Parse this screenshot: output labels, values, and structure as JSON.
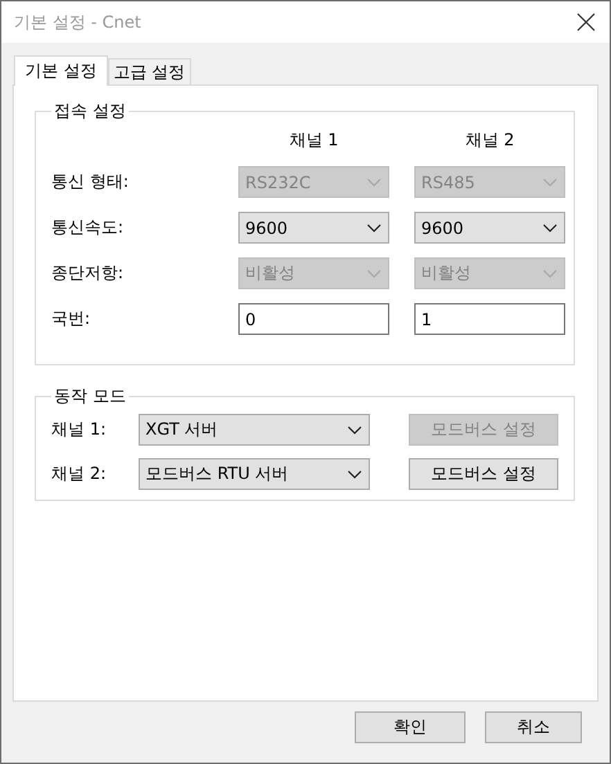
{
  "window": {
    "title": "기본 설정 - Cnet"
  },
  "tabs": [
    {
      "label": "기본 설정",
      "selected": true
    },
    {
      "label": "고급 설정",
      "selected": false
    }
  ],
  "connection_settings": {
    "title": "접속 설정",
    "columns": [
      "채널 1",
      "채널 2"
    ],
    "rows": [
      {
        "label": "통신 형태:",
        "kind": "combo",
        "cells": [
          {
            "value": "RS232C",
            "disabled": true
          },
          {
            "value": "RS485",
            "disabled": true
          }
        ]
      },
      {
        "label": "통신속도:",
        "kind": "combo",
        "cells": [
          {
            "value": "9600",
            "disabled": false
          },
          {
            "value": "9600",
            "disabled": false
          }
        ]
      },
      {
        "label": "종단저항:",
        "kind": "combo",
        "cells": [
          {
            "value": "비활성",
            "disabled": true
          },
          {
            "value": "비활성",
            "disabled": true
          }
        ]
      },
      {
        "label": "국번:",
        "kind": "input",
        "cells": [
          {
            "value": "0",
            "disabled": false
          },
          {
            "value": "1",
            "disabled": false
          }
        ]
      }
    ]
  },
  "operation_mode": {
    "title": "동작 모드",
    "rows": [
      {
        "label": "채널 1:",
        "value": "XGT 서버",
        "button": {
          "label": "모드버스 설정",
          "disabled": true
        }
      },
      {
        "label": "채널 2:",
        "value": "모드버스 RTU 서버",
        "button": {
          "label": "모드버스 설정",
          "disabled": false
        }
      }
    ]
  },
  "buttons": [
    "확인",
    "취소"
  ]
}
